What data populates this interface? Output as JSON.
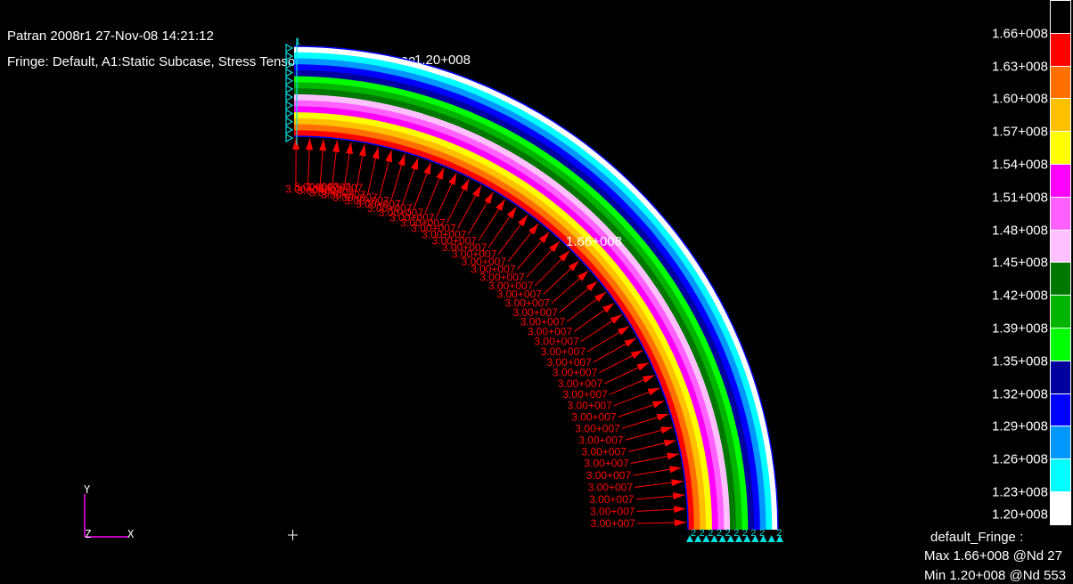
{
  "header": {
    "title": "Patran 2008r1 27-Nov-08 14:21:12",
    "fringe_line": "Fringe: Default, A1:Static Subcase, Stress Tensor, , von Mises, A1:22"
  },
  "model": {
    "band_colors_inner_to_outer": [
      "#ff0000",
      "#ff7000",
      "#ffc000",
      "#ffff00",
      "#ff00ff",
      "#ff60ff",
      "#ffc0ff",
      "#007800",
      "#00b400",
      "#00ff00",
      "#0000a0",
      "#0000ff",
      "#0098ff",
      "#00ffff",
      "#ffffff"
    ],
    "edge_color": "#0000ff",
    "load_label": "3.00+007",
    "load_color": "#ff0000",
    "constraint_color": "#00e0e0",
    "constraint_label_left": "1",
    "constraint_label_bottom": "2",
    "max_marker_label": "1.66+008",
    "min_marker_label": "1.20+008"
  },
  "axes_triad": {
    "x": "X",
    "y": "Y",
    "z": "Z",
    "color": "#ff00ff"
  },
  "legend": {
    "colors_top_to_bottom": [
      "#000000",
      "#ff0000",
      "#ff7000",
      "#ffc000",
      "#ffff00",
      "#ff00ff",
      "#ff60ff",
      "#ffc0ff",
      "#007800",
      "#00b400",
      "#00ff00",
      "#0000a0",
      "#0000ff",
      "#0098ff",
      "#00ffff",
      "#ffffff"
    ],
    "labels": [
      "1.66+008",
      "1.63+008",
      "1.60+008",
      "1.57+008",
      "1.54+008",
      "1.51+008",
      "1.48+008",
      "1.45+008",
      "1.42+008",
      "1.39+008",
      "1.35+008",
      "1.32+008",
      "1.29+008",
      "1.26+008",
      "1.23+008",
      "1.20+008"
    ],
    "name": "default_Fringe :",
    "max": "Max 1.66+008 @Nd 27",
    "min": "Min 1.20+008 @Nd 553"
  }
}
